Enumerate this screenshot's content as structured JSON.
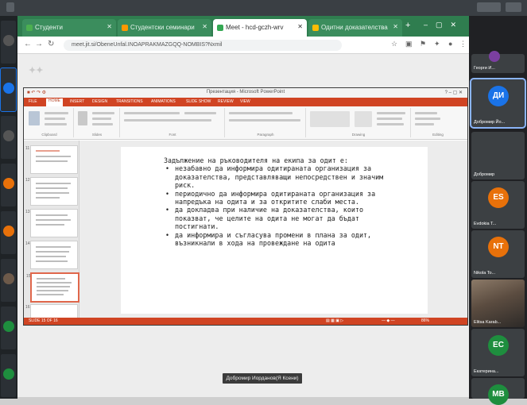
{
  "browser": {
    "tabs": [
      {
        "label": "Студенти",
        "favicon_color": "#4caf50"
      },
      {
        "label": "Студентски семинари",
        "favicon_color": "#ff9800"
      },
      {
        "label": "Meet - hcd-gczh-wrv",
        "favicon_color": "#34a853"
      },
      {
        "label": "Одитни доказателства",
        "favicon_color": "#fbbc04"
      }
    ],
    "active_tab_index": 2,
    "url": "meet.jit.si/ObeneUnfal.INOAPRAKMAZGQQ-NOMBIS?Nxmil"
  },
  "powerpoint": {
    "title": "Презентация - Microsoft PowerPoint",
    "ribbon_tabs": [
      "FILE",
      "HOME",
      "INSERT",
      "DESIGN",
      "TRANSITIONS",
      "ANIMATIONS",
      "SLIDE SHOW",
      "REVIEW",
      "VIEW"
    ],
    "active_ribbon_tab": "HOME",
    "ribbon_groups": [
      "Clipboard",
      "Slides",
      "Font",
      "Paragraph",
      "Drawing",
      "Editing"
    ],
    "slide_numbers": [
      "11",
      "12",
      "13",
      "14",
      "15",
      "16"
    ],
    "selected_slide": "15",
    "slide": {
      "heading": "Задължение на ръководителя на екипа за одит е:",
      "bullets": [
        "незабавно да информира одитираната организация за доказателства, представляващи непосредствен и значим риск.",
        "периодично да информира одитираната организация за напредъка на одита и за откритите слаби места.",
        "да докладва при наличие на доказателства, които показват, че целите на одита не могат да бъдат постигнати.",
        "да информира и съгласува промени в плана за одит, възникнали в хода на провеждане на одита"
      ]
    },
    "status_left": "SLIDE 15 OF 16",
    "zoom": "86%"
  },
  "presenter_label": "Добромир Иорданов(Я Ксени)",
  "participants": [
    {
      "initials": "",
      "name": "Георги И...",
      "color": "#7b3fa0",
      "small": true
    },
    {
      "initials": "ДИ",
      "name": "Добромир Йо...",
      "color": "#1a73e8",
      "speaking": true
    },
    {
      "initials": "",
      "name": "Добромир",
      "color": "#3c4043",
      "photo": false
    },
    {
      "initials": "ES",
      "name": "Evdokia T...",
      "color": "#e8710a"
    },
    {
      "initials": "NT",
      "name": "Nikola To...",
      "color": "#e8710a"
    },
    {
      "initials": "",
      "name": "Elitsa Karab...",
      "color": "#5b4c40",
      "photo": true
    },
    {
      "initials": "EC",
      "name": "Екатерина...",
      "color": "#1e8e3e"
    },
    {
      "initials": "MB",
      "name": "",
      "color": "#1e8e3e"
    }
  ]
}
